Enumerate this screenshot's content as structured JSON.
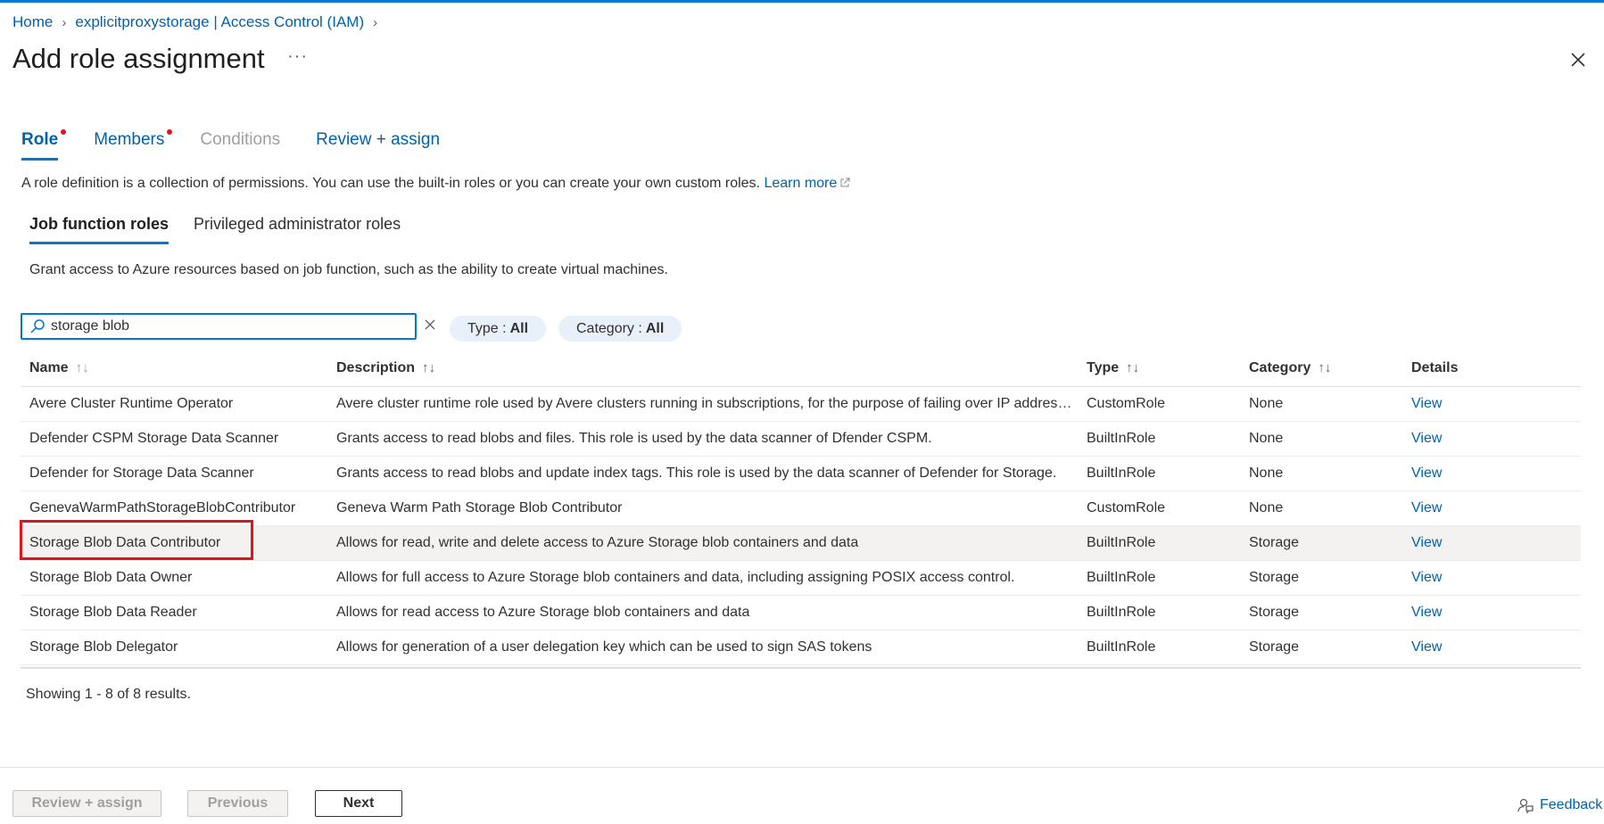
{
  "breadcrumb": {
    "home": "Home",
    "resource": "explicitproxystorage | Access Control (IAM)"
  },
  "page": {
    "title": "Add role assignment",
    "more": "···"
  },
  "wizard_tabs": [
    {
      "label": "Role",
      "state": "active",
      "required": true
    },
    {
      "label": "Members",
      "state": "normal",
      "required": true
    },
    {
      "label": "Conditions",
      "state": "disabled",
      "required": false
    },
    {
      "label": "Review + assign",
      "state": "normal",
      "required": false
    }
  ],
  "description": {
    "text": "A role definition is a collection of permissions. You can use the built-in roles or you can create your own custom roles.",
    "learn_more": "Learn more"
  },
  "sub_tabs": [
    {
      "label": "Job function roles",
      "active": true
    },
    {
      "label": "Privileged administrator roles",
      "active": false
    }
  ],
  "sub_description": "Grant access to Azure resources based on job function, such as the ability to create virtual machines.",
  "search": {
    "value": "storage blob"
  },
  "filters": {
    "type_label": "Type :",
    "type_value": "All",
    "category_label": "Category :",
    "category_value": "All"
  },
  "table": {
    "headers": {
      "name": "Name",
      "description": "Description",
      "type": "Type",
      "category": "Category",
      "details": "Details"
    },
    "rows": [
      {
        "name": "Avere Cluster Runtime Operator",
        "description": "Avere cluster runtime role used by Avere clusters running in subscriptions, for the purpose of failing over IP addresse...",
        "type": "CustomRole",
        "category": "None",
        "details": "View"
      },
      {
        "name": "Defender CSPM Storage Data Scanner",
        "description": "Grants access to read blobs and files. This role is used by the data scanner of Dfender CSPM.",
        "type": "BuiltInRole",
        "category": "None",
        "details": "View"
      },
      {
        "name": "Defender for Storage Data Scanner",
        "description": "Grants access to read blobs and update index tags. This role is used by the data scanner of Defender for Storage.",
        "type": "BuiltInRole",
        "category": "None",
        "details": "View"
      },
      {
        "name": "GenevaWarmPathStorageBlobContributor",
        "description": "Geneva Warm Path Storage Blob Contributor",
        "type": "CustomRole",
        "category": "None",
        "details": "View"
      },
      {
        "name": "Storage Blob Data Contributor",
        "description": "Allows for read, write and delete access to Azure Storage blob containers and data",
        "type": "BuiltInRole",
        "category": "Storage",
        "details": "View"
      },
      {
        "name": "Storage Blob Data Owner",
        "description": "Allows for full access to Azure Storage blob containers and data, including assigning POSIX access control.",
        "type": "BuiltInRole",
        "category": "Storage",
        "details": "View"
      },
      {
        "name": "Storage Blob Data Reader",
        "description": "Allows for read access to Azure Storage blob containers and data",
        "type": "BuiltInRole",
        "category": "Storage",
        "details": "View"
      },
      {
        "name": "Storage Blob Delegator",
        "description": "Allows for generation of a user delegation key which can be used to sign SAS tokens",
        "type": "BuiltInRole",
        "category": "Storage",
        "details": "View"
      }
    ]
  },
  "results_text": "Showing 1 - 8 of 8 results.",
  "footer": {
    "review_assign": "Review + assign",
    "previous": "Previous",
    "next": "Next",
    "feedback": "Feedback"
  },
  "colors": {
    "accent": "#0078d4",
    "link": "#0062ad",
    "required_dot": "#e81123",
    "highlight_box": "#e0121b"
  }
}
